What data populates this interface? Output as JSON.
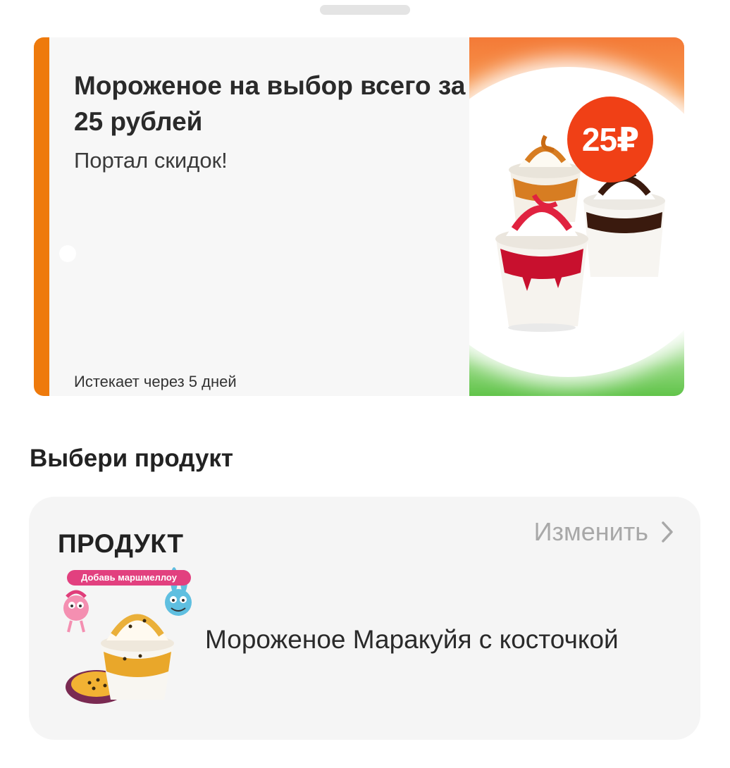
{
  "offer": {
    "title": "Мороженое на выбор всего за 25 рублей",
    "subtitle": "Портал скидок!",
    "expires": "Истекает через 5 дней",
    "price_badge": "25₽",
    "accent_color": "#ee7a0c",
    "badge_color": "#f04016"
  },
  "section": {
    "title": "Выбери продукт"
  },
  "product": {
    "label": "ПРОДУКТ",
    "change_label": "Изменить",
    "change_icon": "chevron-right-icon",
    "image_tag": "Добавь маршмеллоу",
    "name": "Мороженое Маракуйя с косточкой"
  }
}
